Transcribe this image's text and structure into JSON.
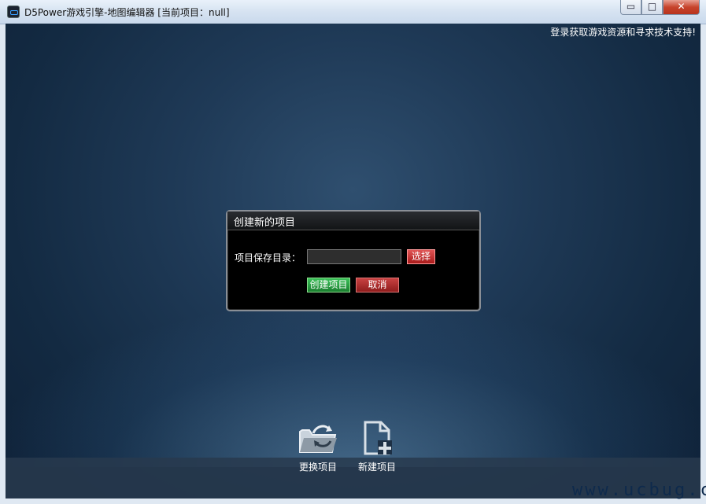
{
  "window": {
    "title": "D5Power游戏引擎-地图编辑器 [当前项目：null]",
    "controls": {
      "minimize": "▭",
      "maximize": "□",
      "close": "✕"
    }
  },
  "top_link": "登录获取游戏资源和寻求技术支持!",
  "dialog": {
    "title": "创建新的项目",
    "dir_label": "项目保存目录：",
    "dir_value": "",
    "choose_label": "选择",
    "create_label": "创建项目",
    "cancel_label": "取消"
  },
  "toolbar": {
    "switch_label": "更换项目",
    "new_label": "新建项目"
  },
  "watermark": "www.ucbug.cc",
  "icons": {
    "app": "app-icon",
    "switch": "folder-switch-icon",
    "new": "new-document-icon"
  }
}
